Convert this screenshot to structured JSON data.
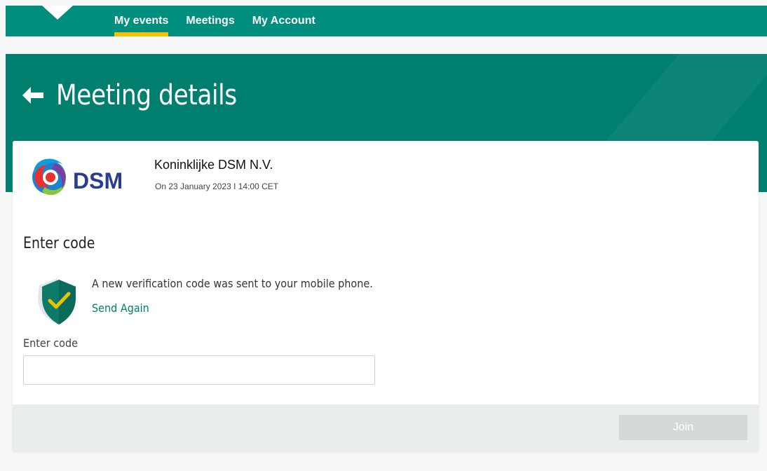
{
  "nav": {
    "items": [
      {
        "label": "My events",
        "active": true
      },
      {
        "label": "Meetings",
        "active": false
      },
      {
        "label": "My Account",
        "active": false
      }
    ],
    "active_underline_color": "#f5c000"
  },
  "hero": {
    "title": "Meeting details",
    "back_icon": "arrow-left-icon",
    "background_color": "#007f6f"
  },
  "meeting": {
    "company": "Koninklijke DSM N.V.",
    "date": "On 23 January 2023 I 14:00 CET",
    "logo": {
      "text": "DSM",
      "text_color": "#2a3c8f"
    }
  },
  "verification": {
    "section_title": "Enter code",
    "message": "A new verification code was sent to your mobile phone.",
    "send_again_label": "Send Again",
    "icon": "shield-check-icon",
    "field_label": "Enter code",
    "field_value": "",
    "field_placeholder": ""
  },
  "footer": {
    "join_label": "Join",
    "join_enabled": false
  },
  "colors": {
    "brand_teal": "#008f7e",
    "link": "#007f6f"
  }
}
